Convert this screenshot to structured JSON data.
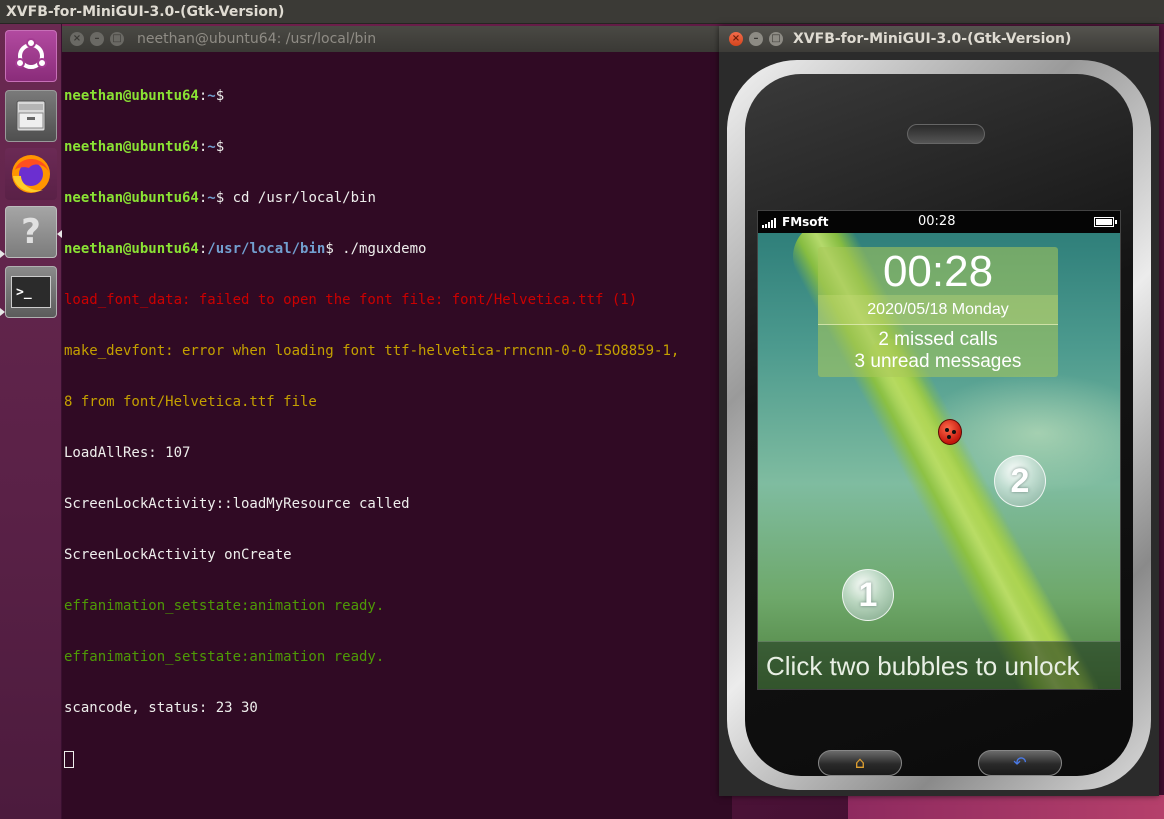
{
  "top_panel": {
    "title": "XVFB-for-MiniGUI-3.0-(Gtk-Version)"
  },
  "launcher": {
    "items": [
      {
        "name": "ubuntu-dash",
        "icon": "ubuntu-logo-icon"
      },
      {
        "name": "files",
        "icon": "file-cabinet-icon"
      },
      {
        "name": "firefox",
        "icon": "firefox-icon"
      },
      {
        "name": "help",
        "icon": "question-icon",
        "glyph": "?"
      },
      {
        "name": "terminal",
        "icon": "terminal-icon",
        "glyph": ">_"
      }
    ]
  },
  "terminal": {
    "title": "neethan@ubuntu64: /usr/local/bin",
    "buttons": {
      "close": "×",
      "min": "–",
      "max": "□"
    },
    "prompt_user": "neethan@ubuntu64",
    "lines": [
      {
        "user": "neethan@ubuntu64",
        "sep": ":",
        "path": "~",
        "dollar": "$",
        "cmd": ""
      },
      {
        "user": "neethan@ubuntu64",
        "sep": ":",
        "path": "~",
        "dollar": "$",
        "cmd": ""
      },
      {
        "user": "neethan@ubuntu64",
        "sep": ":",
        "path": "~",
        "dollar": "$",
        "cmd": " cd /usr/local/bin"
      },
      {
        "user": "neethan@ubuntu64",
        "sep": ":",
        "path": "/usr/local/bin",
        "dollar": "$",
        "cmd": " ./mguxdemo"
      }
    ],
    "output": [
      {
        "text": "load_font_data: failed to open the font file: font/Helvetica.ttf (1)",
        "color": "red"
      },
      {
        "text": "make_devfont: error when loading font ttf-helvetica-rrncnn-0-0-ISO8859-1,",
        "color": "orange"
      },
      {
        "text": "8 from font/Helvetica.ttf file",
        "color": "orange"
      },
      {
        "text": "LoadAllRes: 107",
        "color": "white"
      },
      {
        "text": "ScreenLockActivity::loadMyResource called",
        "color": "white"
      },
      {
        "text": "ScreenLockActivity onCreate",
        "color": "white"
      },
      {
        "text": "effanimation_setstate:animation ready.",
        "color": "green"
      },
      {
        "text": "effanimation_setstate:animation ready.",
        "color": "green"
      },
      {
        "text": "scancode, status: 23 30",
        "color": "white"
      }
    ]
  },
  "emulator": {
    "title": "XVFB-for-MiniGUI-3.0-(Gtk-Version)",
    "buttons": {
      "close": "×",
      "min": "–",
      "max": "□"
    },
    "status_bar": {
      "carrier": "FMsoft",
      "time": "00:28"
    },
    "lock_screen": {
      "clock": "00:28",
      "date": "2020/05/18 Monday",
      "missed_calls": "2 missed calls",
      "unread_messages": "3 unread messages",
      "bubble_1": "1",
      "bubble_2": "2",
      "unlock_hint": "Click two bubbles to unlock"
    },
    "hardware_buttons": {
      "home_glyph": "⌂",
      "back_glyph": "↶"
    }
  },
  "colors": {
    "terminal_bg": "#300a24",
    "prompt_user": "#8ae234",
    "prompt_path": "#729fcf",
    "error_red": "#cc0000",
    "warn_orange": "#c4a000",
    "ok_green": "#4e9a06"
  }
}
